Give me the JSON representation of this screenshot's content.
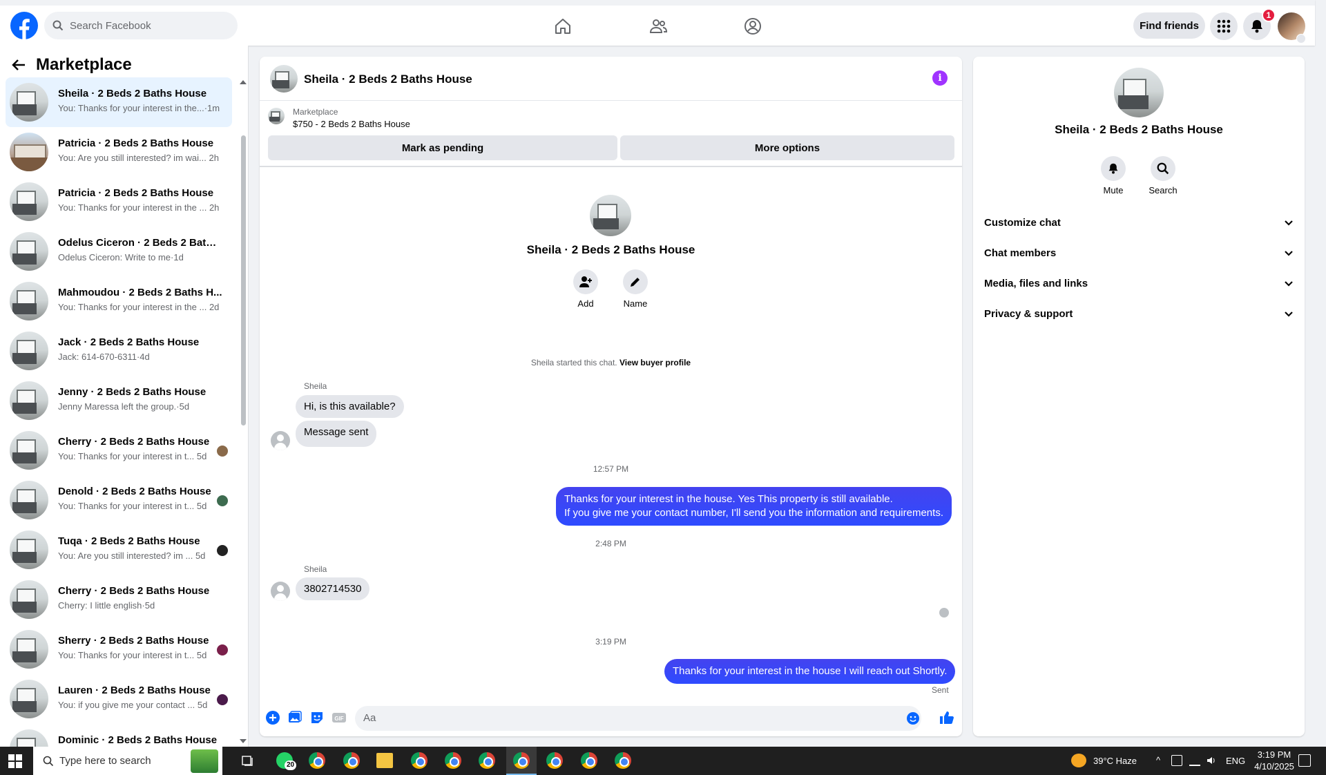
{
  "topbar": {
    "search_placeholder": "Search Facebook",
    "find_friends": "Find friends",
    "notification_count": "1"
  },
  "left": {
    "title": "Marketplace",
    "conversations": [
      {
        "title": "Sheila · 2 Beds 2 Baths House",
        "sub": "You: Thanks for your interest in the...·1m",
        "active": true,
        "mini": ""
      },
      {
        "title": "Patricia · 2 Beds 2 Baths House",
        "sub": "You: Are you still interested? im wai... 2h",
        "active": false,
        "mini": "",
        "photo": "warm"
      },
      {
        "title": "Patricia · 2 Beds 2 Baths House",
        "sub": "You: Thanks for your interest in the ... 2h",
        "active": false,
        "mini": ""
      },
      {
        "title": "Odelus Ciceron · 2 Beds 2 Baths ...",
        "sub": "Odelus Ciceron: Write to me·1d",
        "active": false,
        "mini": ""
      },
      {
        "title": "Mahmoudou · 2 Beds 2 Baths H...",
        "sub": "You: Thanks for your interest in the ... 2d",
        "active": false,
        "mini": ""
      },
      {
        "title": "Jack · 2 Beds 2 Baths House",
        "sub": "Jack: 614-670-6311·4d",
        "active": false,
        "mini": ""
      },
      {
        "title": "Jenny · 2 Beds 2 Baths House",
        "sub": "Jenny Maressa left the group.·5d",
        "active": false,
        "mini": ""
      },
      {
        "title": "Cherry · 2 Beds 2 Baths House",
        "sub": "You: Thanks for your interest in t... 5d",
        "active": false,
        "mini": "#8a6a4a"
      },
      {
        "title": "Denold · 2 Beds 2 Baths House",
        "sub": "You: Thanks for your interest in t... 5d",
        "active": false,
        "mini": "#3d6b4f"
      },
      {
        "title": "Tuqa · 2 Beds 2 Baths House",
        "sub": "You: Are you still interested? im ... 5d",
        "active": false,
        "mini": "#222222"
      },
      {
        "title": "Cherry · 2 Beds 2 Baths House",
        "sub": "Cherry: I little english·5d",
        "active": false,
        "mini": ""
      },
      {
        "title": "Sherry · 2 Beds 2 Baths House",
        "sub": "You: Thanks for your interest in t... 5d",
        "active": false,
        "mini": "#7a1f4a"
      },
      {
        "title": "Lauren · 2 Beds 2 Baths House",
        "sub": "You: if you give me your contact ... 5d",
        "active": false,
        "mini": "#4a1a4a"
      },
      {
        "title": "Dominic · 2 Beds 2 Baths House",
        "sub": "",
        "active": false,
        "mini": ""
      }
    ]
  },
  "chat": {
    "title": "Sheila · 2 Beds 2 Baths House",
    "listing_label": "Marketplace",
    "listing_price": "$750 - 2 Beds 2 Baths House",
    "mark_pending": "Mark as pending",
    "more_options": "More options",
    "intro_name": "Sheila · 2 Beds 2 Baths House",
    "add_label": "Add",
    "name_label": "Name",
    "started_text": "Sheila started this chat.",
    "view_buyer": "View buyer profile",
    "sender1": "Sheila",
    "msg1": "Hi, is this available?",
    "msg2": "Message sent",
    "time1": "12:57 PM",
    "out1_line1": "Thanks for your interest in the house. Yes This property is still available.",
    "out1_line2": "If you give me your contact number, I'll send you the information and requirements.",
    "time2": "2:48 PM",
    "sender2": "Sheila",
    "msg3": "3802714530",
    "time3": "3:19 PM",
    "out2": "Thanks for your interest in the house I will reach out Shortly.",
    "sent_label": "Sent",
    "composer_placeholder": "Aa"
  },
  "right": {
    "name": "Sheila · 2 Beds 2 Baths House",
    "mute": "Mute",
    "search": "Search",
    "sections": [
      "Customize chat",
      "Chat members",
      "Media, files and links",
      "Privacy & support"
    ]
  },
  "taskbar": {
    "search_placeholder": "Type here to search",
    "whatsapp_badge": "20",
    "weather": "39°C  Haze",
    "lang": "ENG",
    "time": "3:19 PM",
    "date": "4/10/2025"
  },
  "colors": {
    "brand_blue": "#0866ff",
    "outgoing_bubble": "#3b48f5",
    "info_purple": "#a033ff",
    "badge_red": "#e41e3f"
  }
}
